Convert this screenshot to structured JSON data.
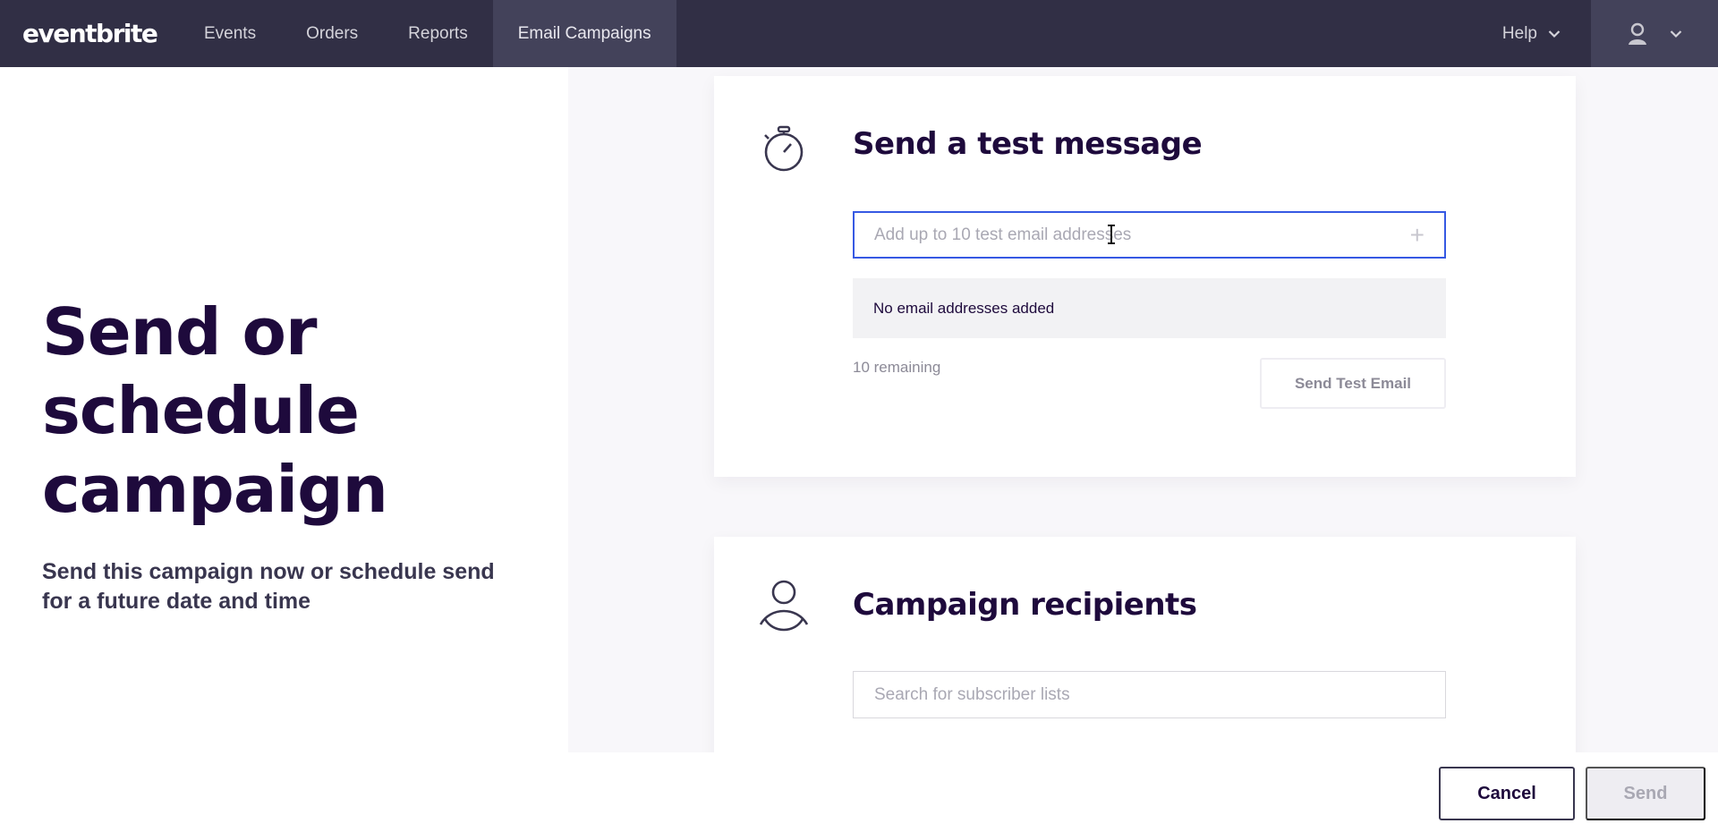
{
  "nav": {
    "logo": "eventbrite",
    "links": [
      "Events",
      "Orders",
      "Reports",
      "Email Campaigns"
    ],
    "active_link": "Email Campaigns",
    "help_label": "Help"
  },
  "hero": {
    "title": "Send or schedule campaign",
    "subtitle": "Send this campaign now or schedule send for a future date and time"
  },
  "test_message": {
    "title": "Send a test message",
    "input_placeholder": "Add up to 10 test email addresses",
    "input_value": "",
    "empty_text": "No email addresses added",
    "remaining_text": "10 remaining",
    "send_button_label": "Send Test Email"
  },
  "recipients": {
    "title": "Campaign recipients",
    "search_placeholder": "Search for subscriber lists"
  },
  "actions": {
    "cancel_label": "Cancel",
    "send_label": "Send"
  },
  "icons": {
    "test_message": "stopwatch-icon",
    "recipients": "person-icon",
    "add": "plus-icon",
    "help_dropdown": "chevron-down-icon",
    "account": "user-icon"
  },
  "colors": {
    "nav_bg": "#312f45",
    "nav_active_bg": "#43425a",
    "focus_border": "#3659e3",
    "heading": "#1e0a3c",
    "page_bg": "#f8f7fa"
  }
}
